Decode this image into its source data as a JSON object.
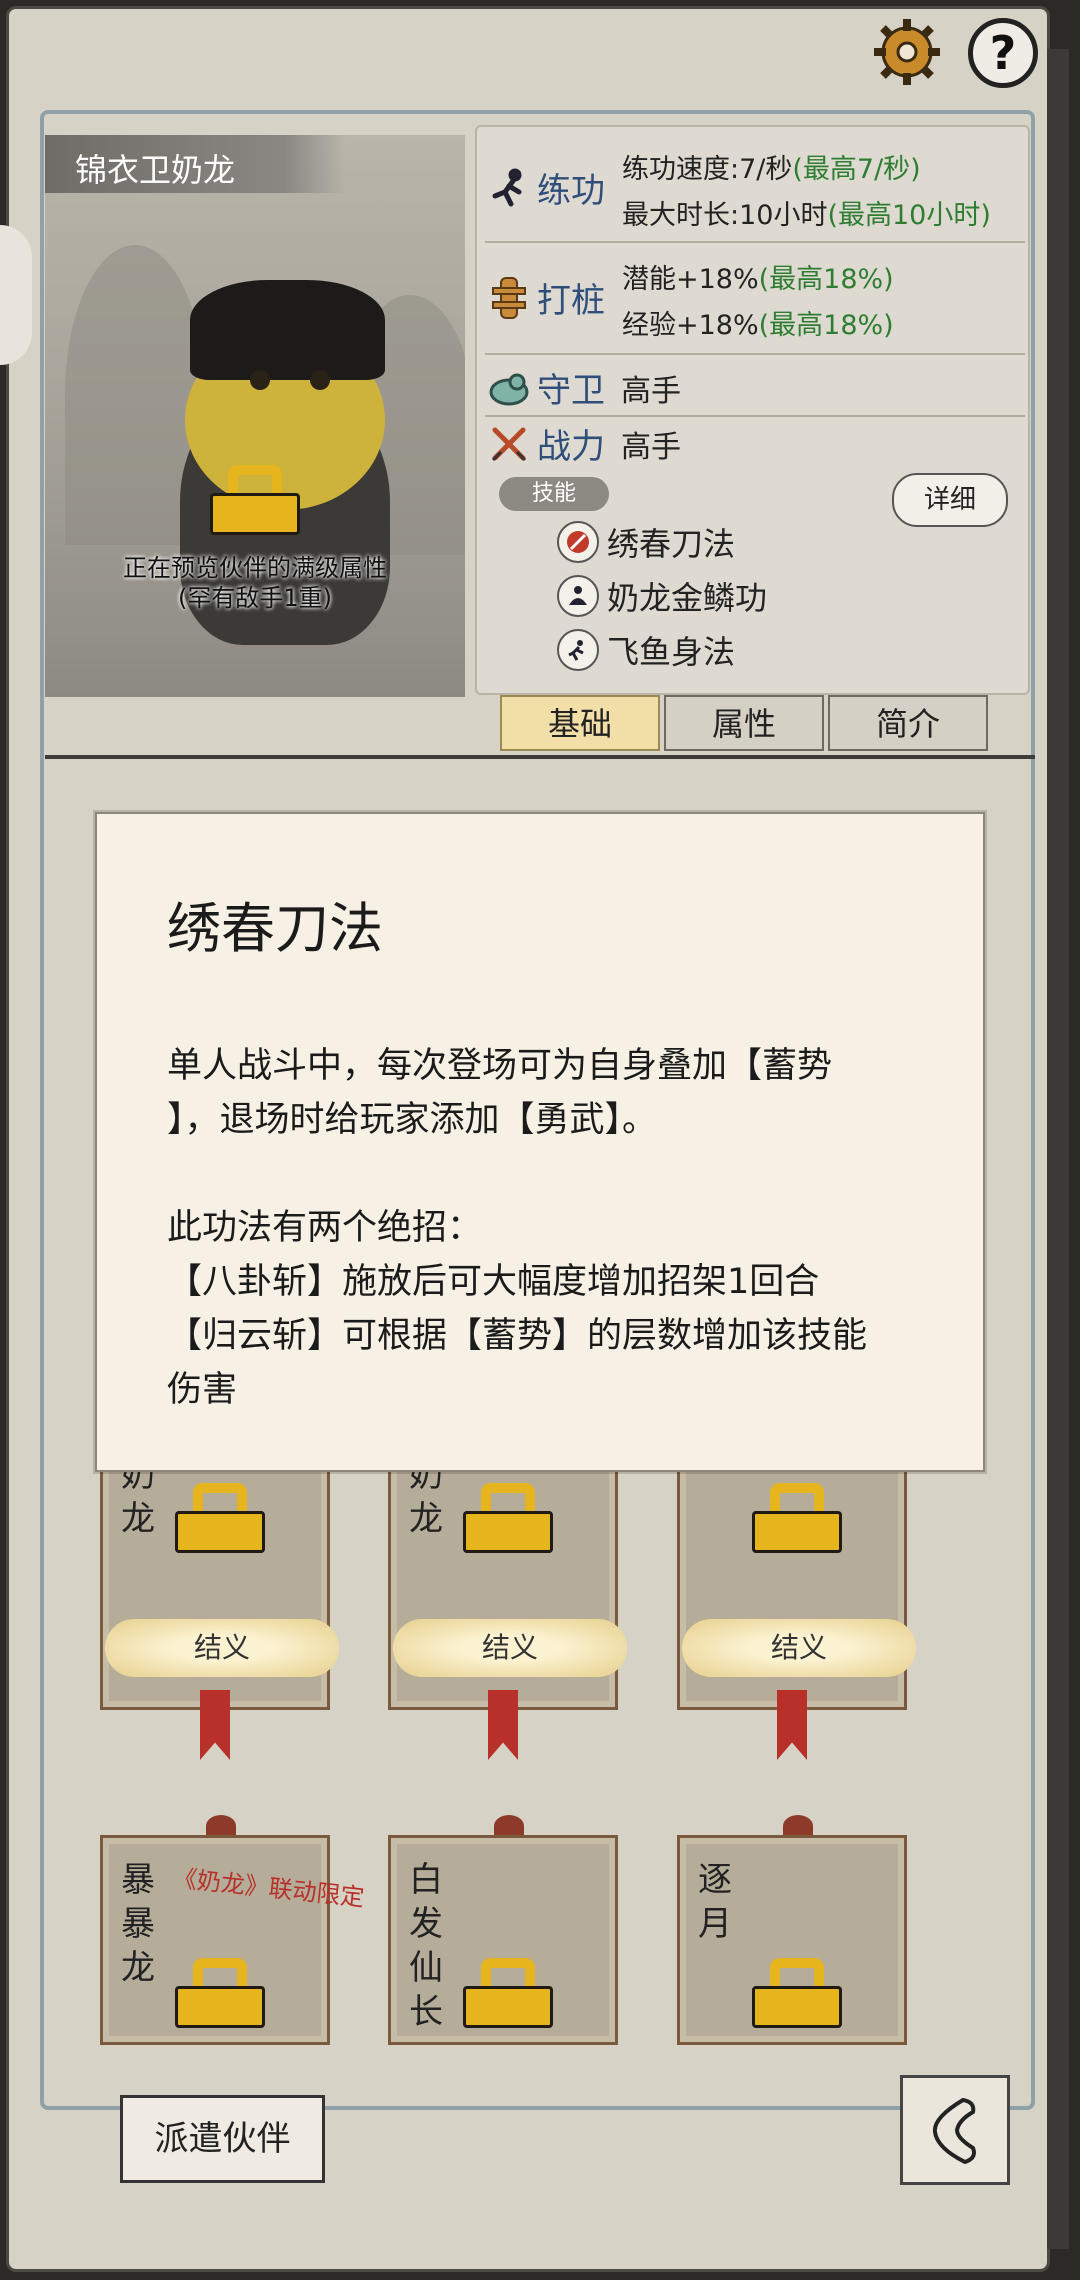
{
  "companion": {
    "name": "锦衣卫奶龙",
    "preview_note_1": "正在预览伙伴的满级属性",
    "preview_note_2": "(罕有敌手1重)"
  },
  "stats": {
    "practice": {
      "label": "练功",
      "line1": "练功速度:7/秒",
      "line1_max": "(最高7/秒)",
      "line2": "最大时长:10小时",
      "line2_max": "(最高10小时)"
    },
    "stake": {
      "label": "打桩",
      "line1": "潜能+18%",
      "line1_max": "(最高18%)",
      "line2": "经验+18%",
      "line2_max": "(最高18%)"
    },
    "guard": {
      "label": "守卫",
      "value": "高手"
    },
    "combat": {
      "label": "战力",
      "value": "高手"
    },
    "skills_label": "技能",
    "detail_button": "详细",
    "skills": [
      "绣春刀法",
      "奶龙金鳞功",
      "飞鱼身法"
    ]
  },
  "tabs": [
    "基础",
    "属性",
    "简介"
  ],
  "popup": {
    "title": "绣春刀法",
    "body": "单人战斗中，每次登场可为自身叠加【蓄势\n】，退场时给玩家添加【勇武】。\n\n此功法有两个绝招：\n【八卦斩】施放后可大幅度增加招架1回合\n【归云斩】可根据【蓄势】的层数增加该技能\n伤害"
  },
  "cards_row1": [
    {
      "name": "奶龙",
      "button": "结义"
    },
    {
      "name": "奶龙",
      "button": "结义"
    },
    {
      "name": "",
      "button": "结义"
    }
  ],
  "cards_row2": [
    {
      "name": "暴暴龙",
      "tag": "《奶龙》联动限定"
    },
    {
      "name": "白发仙长"
    },
    {
      "name": "逐月"
    }
  ],
  "dispatch_button": "派遣伙伴",
  "help_icon": "?",
  "colors": {
    "accent_gold": "#e6b41c",
    "green": "#2e7d32",
    "ribbon_red": "#b8302a"
  }
}
